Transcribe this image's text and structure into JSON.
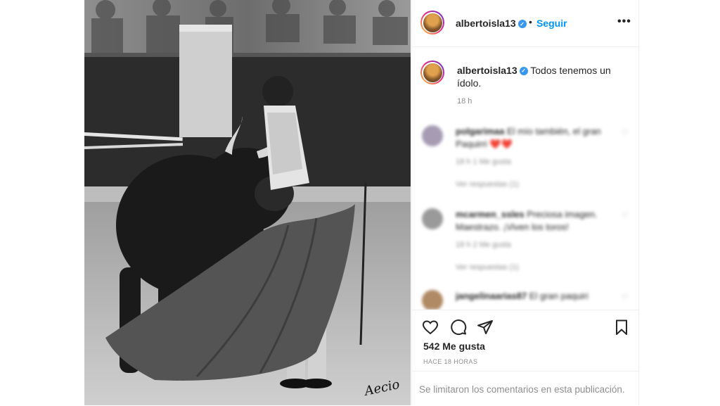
{
  "post": {
    "username": "albertoisla13",
    "separator": "•",
    "follow_label": "Seguir",
    "more_icon": "more-horizontal-icon",
    "more_label": "•••"
  },
  "caption": {
    "username": "albertoisla13",
    "text": "Todos tenemos un ídolo.",
    "time": "18 h"
  },
  "comments": [
    {
      "username": "polgarimaa",
      "text": "El mío también, el gran Paquirri ❤️❤️",
      "meta": "18 h   1 Me gusta",
      "replies": "Ver respuestas (1)"
    },
    {
      "username": "mcarmen_ssles",
      "text": "Preciosa imagen. Maestrazo. ¡Viven los toros!",
      "meta": "18 h   2 Me gusta",
      "replies": "Ver respuestas (1)"
    },
    {
      "username": "jangelinaarias87",
      "text": "El gran paquiri",
      "meta": "",
      "replies": ""
    }
  ],
  "actions": {
    "like_icon": "heart-icon",
    "comment_icon": "comment-icon",
    "share_icon": "share-icon",
    "save_icon": "bookmark-icon",
    "likes": "542 Me gusta",
    "when": "HACE 18 HORAS"
  },
  "footer": {
    "notice": "Se limitaron los comentarios en esta publicación."
  },
  "photo": {
    "signature": "Aecio"
  },
  "colors": {
    "accent": "#0095f6",
    "verified": "#3897f0",
    "muted": "#8e8e8e"
  }
}
